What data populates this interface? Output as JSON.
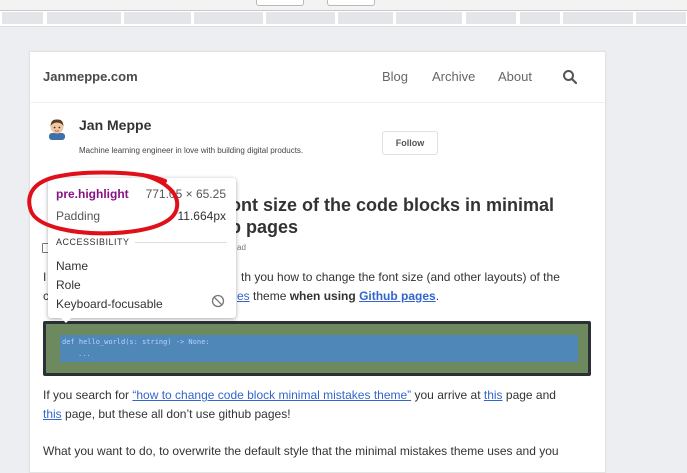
{
  "site": {
    "title": "Janmeppe.com",
    "nav": [
      "Blog",
      "Archive",
      "About"
    ]
  },
  "author": {
    "name": "Jan Meppe",
    "bio": "Machine learning engineer in love with building digital products.",
    "follow_label": "Follow"
  },
  "post": {
    "title_part1": "",
    "title_line1": "ont size of the code blocks in minimal",
    "title_line2": "b pages",
    "meta_left": "",
    "meta_right": "ad",
    "intro_a": "I",
    "intro_b": "th you how to change the font size (and other layouts) of the",
    "intro_c": "c",
    "intro_link1": "es",
    "intro_d": " theme ",
    "intro_bold": "when using ",
    "intro_link2": "Github pages",
    "intro_end": ".",
    "code_line1": "def hello_world(s: string) -> None:",
    "code_line2": "...",
    "p2_a": "If you search for ",
    "p2_link1": "“how to change code block minimal mistakes theme”",
    "p2_b": " you arrive at ",
    "p2_link2": "this",
    "p2_c": " page and",
    "p2_link3": "this",
    "p2_d": " page, but these all don’t use github pages!",
    "p3": "What you want to do, to overwrite the default style that the minimal mistakes theme uses and you"
  },
  "tooltip": {
    "selector": "pre.highlight",
    "dimensions": "771.05 × 65.25",
    "padding_label": "Padding",
    "padding_value": "11.664px",
    "section": "ACCESSIBILITY",
    "props": [
      "Name",
      "Role",
      "Keyboard-focusable"
    ],
    "focusable_icon": "ban-icon"
  },
  "annotation": {
    "color": "#e0101a",
    "shape": "hand-drawn-circle"
  },
  "colors": {
    "selector": "#881280",
    "link": "#3366cc",
    "code_bg": "#2a3036",
    "padding_overlay": "#6c8a5e",
    "content_overlay": "#4f87b8"
  }
}
